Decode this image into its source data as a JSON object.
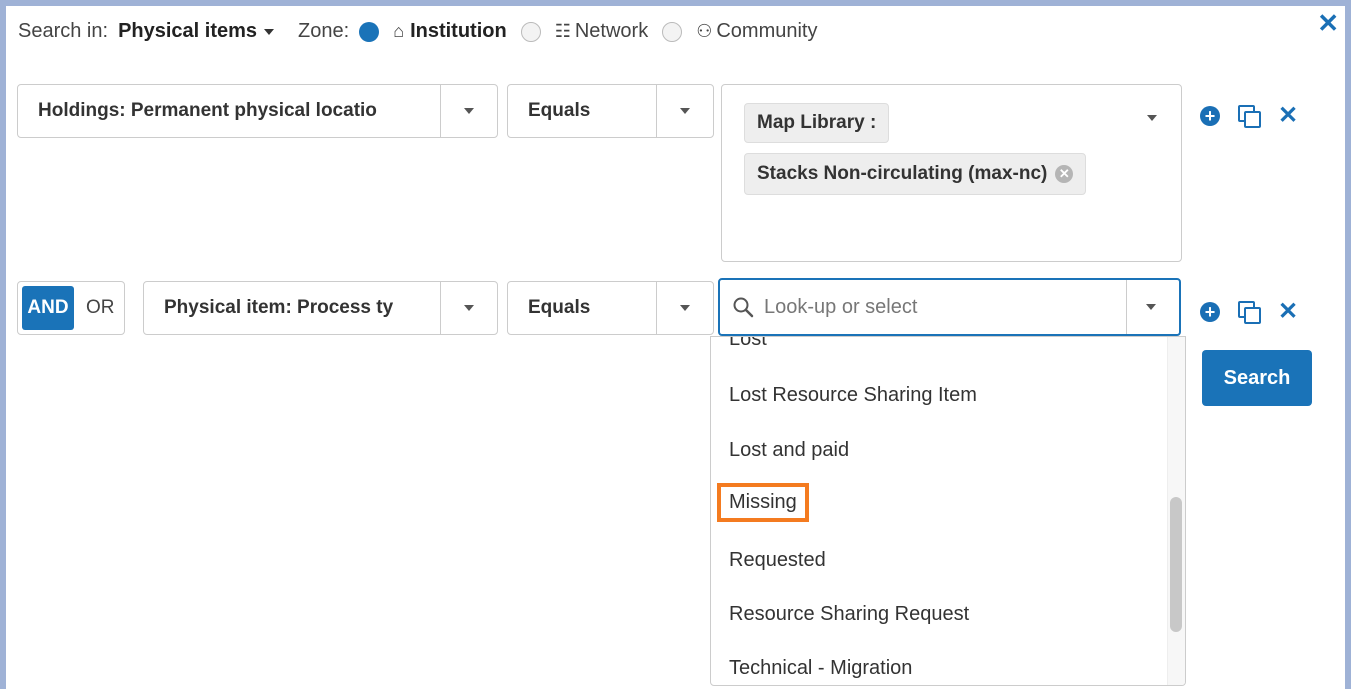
{
  "header": {
    "search_in_label": "Search in:",
    "search_in_value": "Physical items",
    "zone_label": "Zone:",
    "zones": [
      {
        "label": "Institution",
        "selected": true,
        "icon": "home-icon"
      },
      {
        "label": "Network",
        "selected": false,
        "icon": "network-icon"
      },
      {
        "label": "Community",
        "selected": false,
        "icon": "users-icon"
      }
    ]
  },
  "rows": [
    {
      "field": "Holdings: Permanent physical locatio",
      "operator": "Equals",
      "values": [
        "Map Library :",
        "Stacks Non-circulating (max-nc)"
      ]
    },
    {
      "boolean": {
        "and": "AND",
        "or": "OR",
        "selected": "AND"
      },
      "field": "Physical item: Process ty",
      "operator": "Equals",
      "lookup_placeholder": "Look-up or select"
    }
  ],
  "dropdown_options": [
    "Lost",
    "Lost Resource Sharing Item",
    "Lost and paid",
    "Missing",
    "Requested",
    "Resource Sharing Request",
    "Technical - Migration"
  ],
  "highlighted_option": "Missing",
  "search_button": "Search",
  "colors": {
    "accent": "#1a73b8",
    "highlight": "#f47b20",
    "frame": "#9fb2d6"
  }
}
